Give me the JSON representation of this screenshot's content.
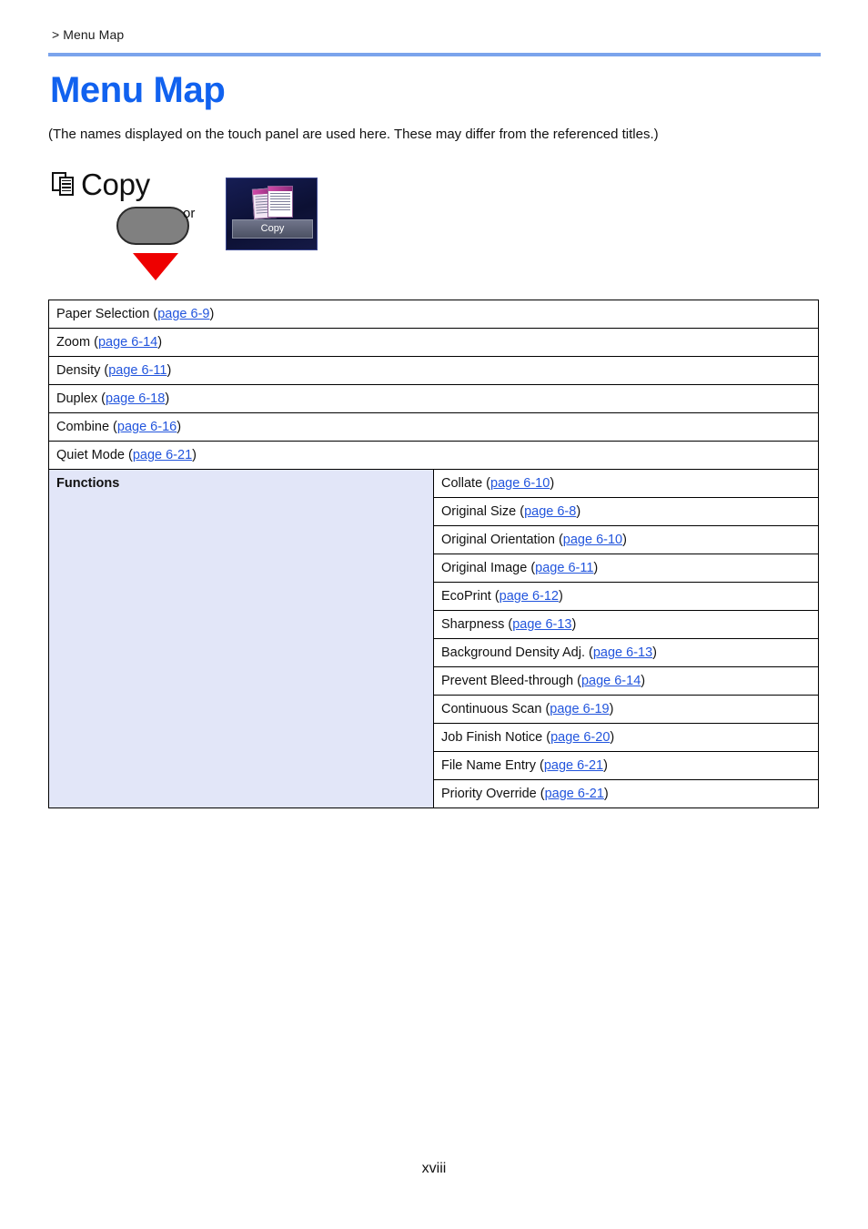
{
  "header": {
    "breadcrumb": "> Menu Map",
    "rule_color": "#7ba4ec"
  },
  "title": {
    "text": "Menu Map",
    "color": "#1162ef"
  },
  "note": "(The names displayed on the touch panel are used here. These may differ from the referenced titles.)",
  "key_illustration": {
    "key_icon_name": "copy-key-icon",
    "key_label": "Copy",
    "or_label": "or",
    "panel_tile_caption": "Copy",
    "arrow_color": "#ee0000",
    "button_color": "#808080",
    "tile_background": "#10153f"
  },
  "table": {
    "top_rows": [
      {
        "label": "Paper Selection",
        "ref": "page 6-9"
      },
      {
        "label": "Zoom",
        "ref": "page 6-14"
      },
      {
        "label": "Density",
        "ref": "page 6-11"
      },
      {
        "label": "Duplex",
        "ref": "page 6-18"
      },
      {
        "label": "Combine",
        "ref": "page 6-16"
      },
      {
        "label": "Quiet Mode",
        "ref": "page 6-21"
      }
    ],
    "functions_label": "Functions",
    "functions_cell_color": "#e2e6f8",
    "functions_rows": [
      {
        "label": "Collate",
        "ref": "page 6-10"
      },
      {
        "label": "Original Size",
        "ref": "page 6-8"
      },
      {
        "label": "Original Orientation",
        "ref": "page 6-10"
      },
      {
        "label": "Original Image",
        "ref": "page 6-11"
      },
      {
        "label": "EcoPrint",
        "ref": "page 6-12"
      },
      {
        "label": "Sharpness",
        "ref": "page 6-13"
      },
      {
        "label": "Background Density Adj.",
        "ref": "page 6-13"
      },
      {
        "label": "Prevent Bleed-through",
        "ref": "page 6-14"
      },
      {
        "label": "Continuous Scan",
        "ref": "page 6-19"
      },
      {
        "label": "Job Finish Notice",
        "ref": "page 6-20"
      },
      {
        "label": "File Name Entry",
        "ref": "page 6-21"
      },
      {
        "label": "Priority Override",
        "ref": "page 6-21"
      }
    ]
  },
  "folio": "xviii"
}
